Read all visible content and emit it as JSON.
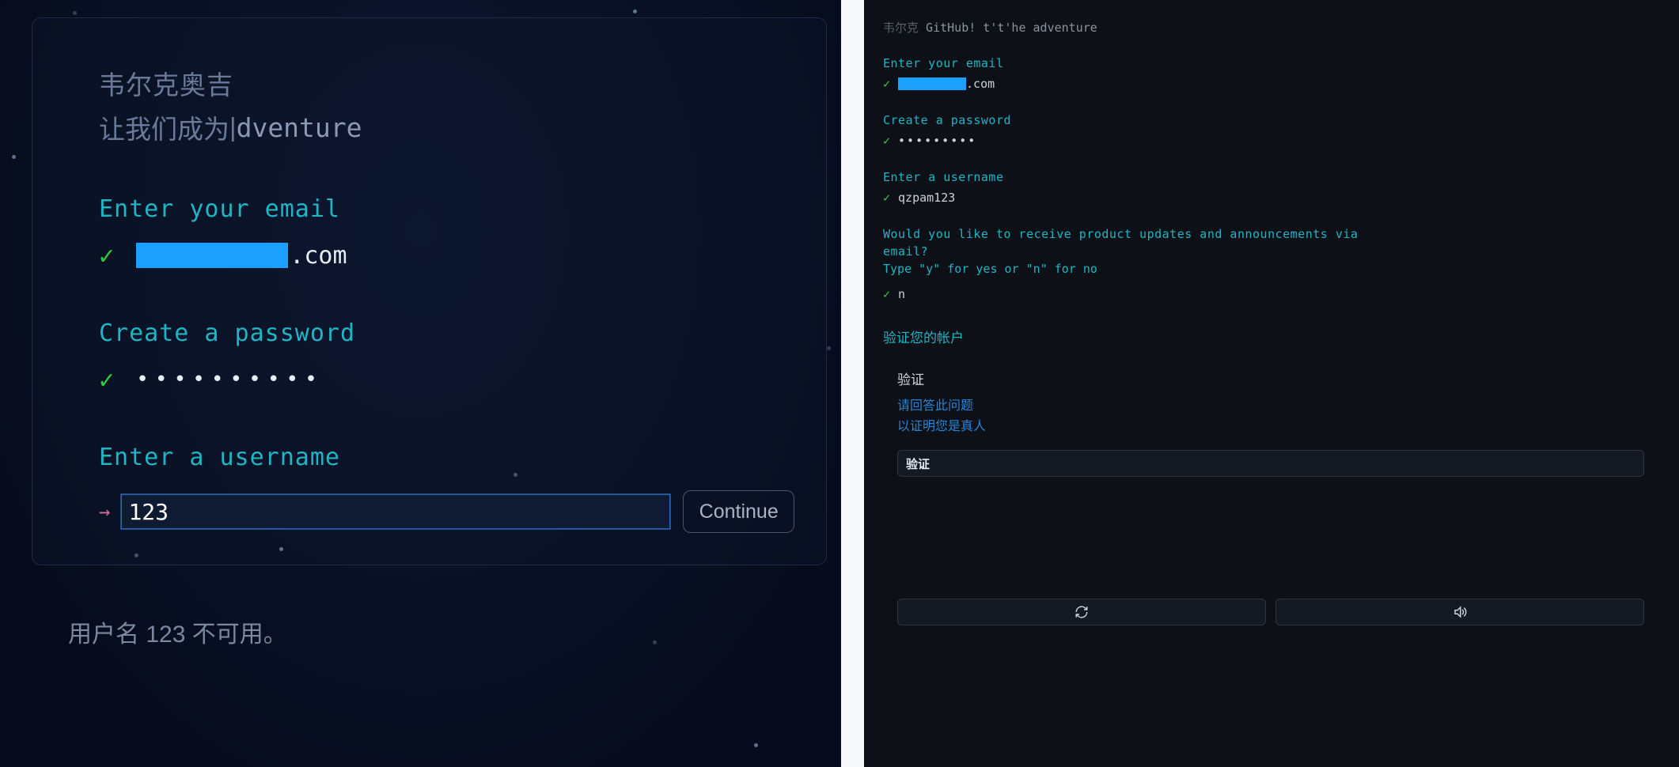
{
  "left": {
    "greeting_line1": "韦尔克奥吉",
    "greeting_line2_prefix": "让我们成为",
    "greeting_line2_cursor": "|",
    "greeting_line2_suffix": "dventure",
    "email": {
      "label": "Enter your email",
      "suffix": ".com"
    },
    "password": {
      "label": "Create a password",
      "dots": "••••••••••"
    },
    "username": {
      "label": "Enter a username",
      "value": "123"
    },
    "continue": "Continue",
    "error": "用户名 123 不可用。"
  },
  "right": {
    "welcome_prefix": "韦尔克",
    "welcome_main": "GitHub! t't'he adventure",
    "email": {
      "label": "Enter your email",
      "suffix": ".com"
    },
    "password": {
      "label": "Create a password",
      "dots": "•••••••••"
    },
    "username": {
      "label": "Enter a username",
      "value": "qzpam123"
    },
    "updates": {
      "label_line1": "Would you like to receive product updates and announcements via",
      "label_line2": "email?",
      "type_hint": "Type \"y\" for yes or \"n\" for no",
      "value": "n"
    },
    "verify_section_title": "验证您的帐户",
    "captcha": {
      "title": "验证",
      "line1": "请回答此问题",
      "line2": "以证明您是真人",
      "button": "验证"
    }
  }
}
